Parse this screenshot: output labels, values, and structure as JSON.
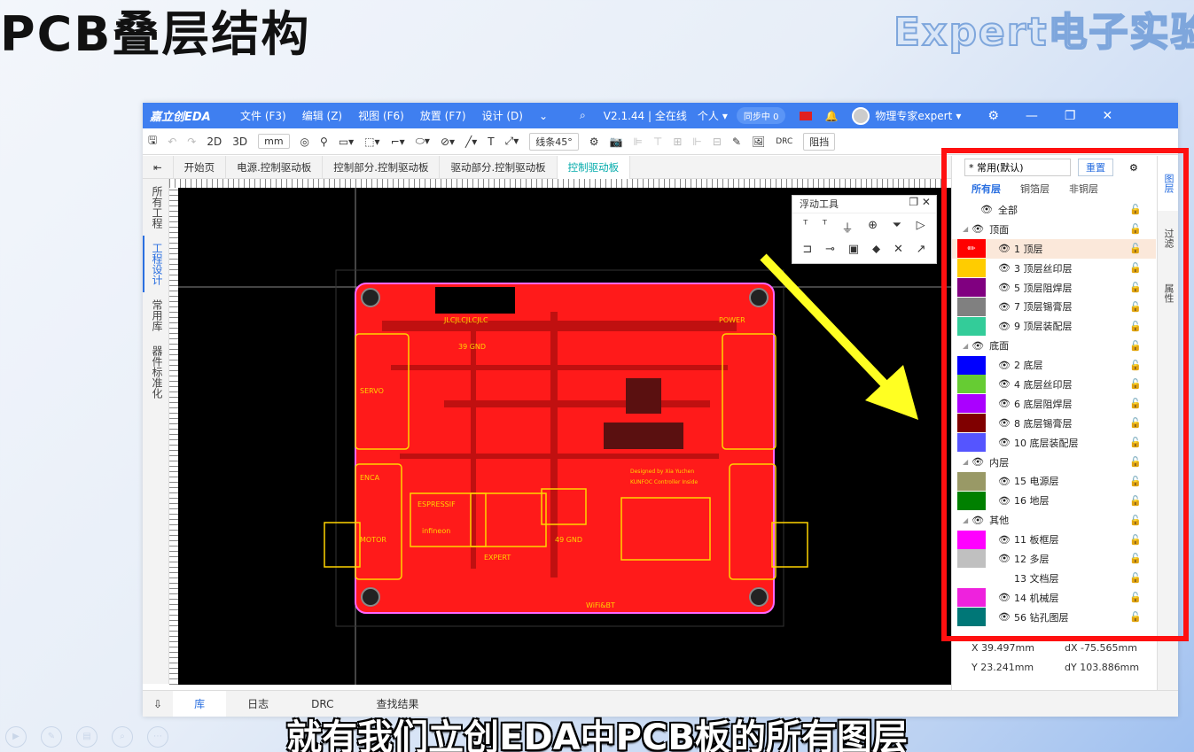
{
  "slide": {
    "title": "PCB叠层结构",
    "watermark": "Expert电子实验",
    "subtitle": "就有我们立创EDA中PCB板的所有图层"
  },
  "titlebar": {
    "logo": "嘉立创EDA",
    "menus": [
      "文件 (F3)",
      "编辑 (Z)",
      "视图 (F6)",
      "放置 (F7)",
      "设计 (D)"
    ],
    "version": "V2.1.44 | 全在线",
    "personal": "个人",
    "sync": "同步中 0",
    "user": "物理专家expert"
  },
  "toolbar": {
    "mode_2d": "2D",
    "mode_3d": "3D",
    "unit": "mm",
    "line_mode": "线条45°",
    "block": "阻挡",
    "drc": "DRC"
  },
  "tabs": [
    "开始页",
    "电源.控制驱动板",
    "控制部分.控制驱动板",
    "驱动部分.控制驱动板",
    "控制驱动板"
  ],
  "left_sidebar": [
    "所有工程",
    "工程设计",
    "常用库",
    "器件标准化"
  ],
  "float_tool": {
    "title": "浮动工具"
  },
  "board": {
    "labels": [
      "JLCJLCJLCJLC",
      "39 GND",
      "49 GND",
      "SERVO",
      "ENCA",
      "MOTOR",
      "infineon",
      "ESPRESSIF",
      "EXPERT",
      "WiFi&BT",
      "POWER",
      "Designed by Xia Yuchen",
      "KUNFOC Controller Inside"
    ],
    "colors": {
      "board": "#ff1a1a",
      "silk": "#ffd400",
      "bg": "#000000"
    }
  },
  "right_panel": {
    "preset": "* 常用(默认)",
    "reset": "重置",
    "tabs": [
      "所有层",
      "铜箔层",
      "非铜层"
    ],
    "side_tabs": [
      "图层",
      "过滤",
      "属性"
    ],
    "layers": [
      {
        "label": "全部",
        "type": "all"
      },
      {
        "label": "顶面",
        "type": "group"
      },
      {
        "label": "1 顶层",
        "color": "#ff0000",
        "selected": true
      },
      {
        "label": "3 顶层丝印层",
        "color": "#ffcc00"
      },
      {
        "label": "5 顶层阻焊层",
        "color": "#800080"
      },
      {
        "label": "7 顶层锡膏层",
        "color": "#808080"
      },
      {
        "label": "9 顶层装配层",
        "color": "#33cc99"
      },
      {
        "label": "底面",
        "type": "group"
      },
      {
        "label": "2 底层",
        "color": "#0000ff"
      },
      {
        "label": "4 底层丝印层",
        "color": "#66cc33"
      },
      {
        "label": "6 底层阻焊层",
        "color": "#aa00ff"
      },
      {
        "label": "8 底层锡膏层",
        "color": "#800000"
      },
      {
        "label": "10 底层装配层",
        "color": "#5555ff"
      },
      {
        "label": "内层",
        "type": "group"
      },
      {
        "label": "15 电源层",
        "color": "#999966"
      },
      {
        "label": "16 地层",
        "color": "#008000"
      },
      {
        "label": "其他",
        "type": "group"
      },
      {
        "label": "11 板框层",
        "color": "#ff00ff"
      },
      {
        "label": "12 多层",
        "color": "#c0c0c0"
      },
      {
        "label": "13 文档层",
        "color": "#ffffff"
      },
      {
        "label": "14 机械层",
        "color": "#ee22dd"
      },
      {
        "label": "56 钻孔图层",
        "color": "#007777"
      }
    ],
    "coords": {
      "x": "X  39.497mm",
      "y": "Y  23.241mm",
      "dx": "dX  -75.565mm",
      "dy": "dY  103.886mm"
    }
  },
  "bottom_tabs": [
    "库",
    "日志",
    "DRC",
    "查找结果"
  ]
}
